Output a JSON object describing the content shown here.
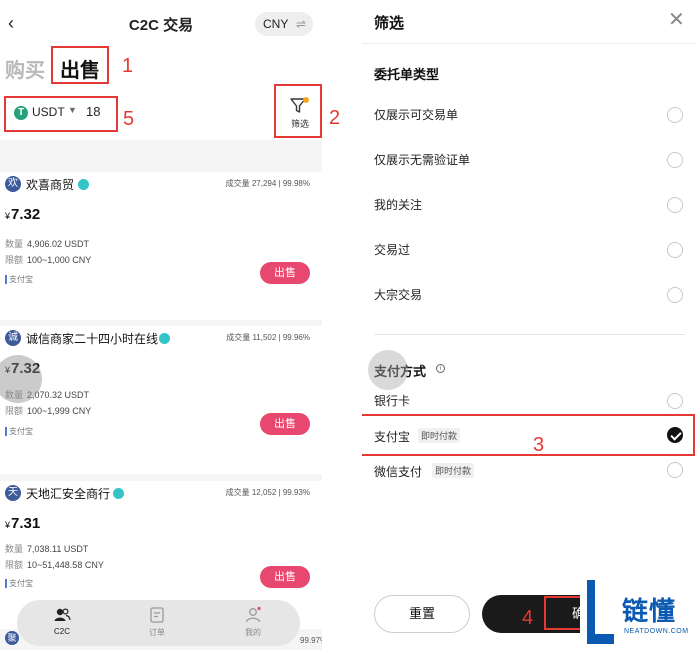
{
  "left": {
    "header": {
      "title": "C2C 交易",
      "currency": "CNY",
      "swap_glyph": "⇌",
      "back_glyph": "‹"
    },
    "tabs": {
      "buy": "购买",
      "sell": "出售"
    },
    "filter_bar": {
      "coin": "USDT",
      "coin_icon_letter": "T",
      "amount": "18",
      "filter_label": "筛选"
    },
    "ads": [
      {
        "avatar": "欢",
        "merchant": "欢喜商贸",
        "volume_label": "成交量",
        "volume": "27,294",
        "rate": "99.98%",
        "currency_symbol": "¥",
        "price": "7.32",
        "qty_label": "数量",
        "qty": "4,906.02 USDT",
        "limit_label": "限额",
        "limit": "100~1,000 CNY",
        "payment": "支付宝",
        "action": "出售"
      },
      {
        "avatar": "诚",
        "merchant": "诚信商家二十四小时在线",
        "volume_label": "成交量",
        "volume": "11,502",
        "rate": "99.96%",
        "currency_symbol": "¥",
        "price": "7.32",
        "qty_label": "数量",
        "qty": "2,070.32 USDT",
        "limit_label": "限额",
        "limit": "100~1,999 CNY",
        "payment": "支付宝",
        "action": "出售"
      },
      {
        "avatar": "天",
        "merchant": "天地汇安全商行",
        "volume_label": "成交量",
        "volume": "12,052",
        "rate": "99.93%",
        "currency_symbol": "¥",
        "price": "7.31",
        "qty_label": "数量",
        "qty": "7,038.11 USDT",
        "limit_label": "限额",
        "limit": "10~51,448.58 CNY",
        "payment": "支付宝",
        "action": "出售"
      }
    ],
    "bottom_peek": {
      "avatar": "聚",
      "rate": "99.97%"
    },
    "nav": [
      {
        "label": "C2C",
        "icon": "users-icon",
        "active": true
      },
      {
        "label": "订单",
        "icon": "order-icon",
        "active": false
      },
      {
        "label": "我的",
        "icon": "profile-icon",
        "active": false
      }
    ]
  },
  "right": {
    "title": "筛选",
    "close_glyph": "✕",
    "order_type": {
      "title": "委托单类型",
      "options": [
        {
          "label": "仅展示可交易单",
          "checked": false
        },
        {
          "label": "仅展示无需验证单",
          "checked": false
        },
        {
          "label": "我的关注",
          "checked": false
        },
        {
          "label": "交易过",
          "checked": false
        },
        {
          "label": "大宗交易",
          "checked": false
        }
      ]
    },
    "payment": {
      "title": "支付方式",
      "info_glyph": "i",
      "options": [
        {
          "label": "银行卡",
          "tag": "",
          "checked": false
        },
        {
          "label": "支付宝",
          "tag": "即时付款",
          "checked": true
        },
        {
          "label": "微信支付",
          "tag": "即时付款",
          "checked": false
        }
      ]
    },
    "buttons": {
      "reset": "重置",
      "confirm": "确"
    }
  },
  "annotations": [
    "1",
    "2",
    "3",
    "4",
    "5"
  ],
  "logo": {
    "name": "链懂",
    "sub": "NEATDOWN.COM"
  },
  "colors": {
    "sell_button": "#e8476f",
    "annotation": "#e53935",
    "logo": "#0a5ab2",
    "usdt": "#26a17b"
  }
}
